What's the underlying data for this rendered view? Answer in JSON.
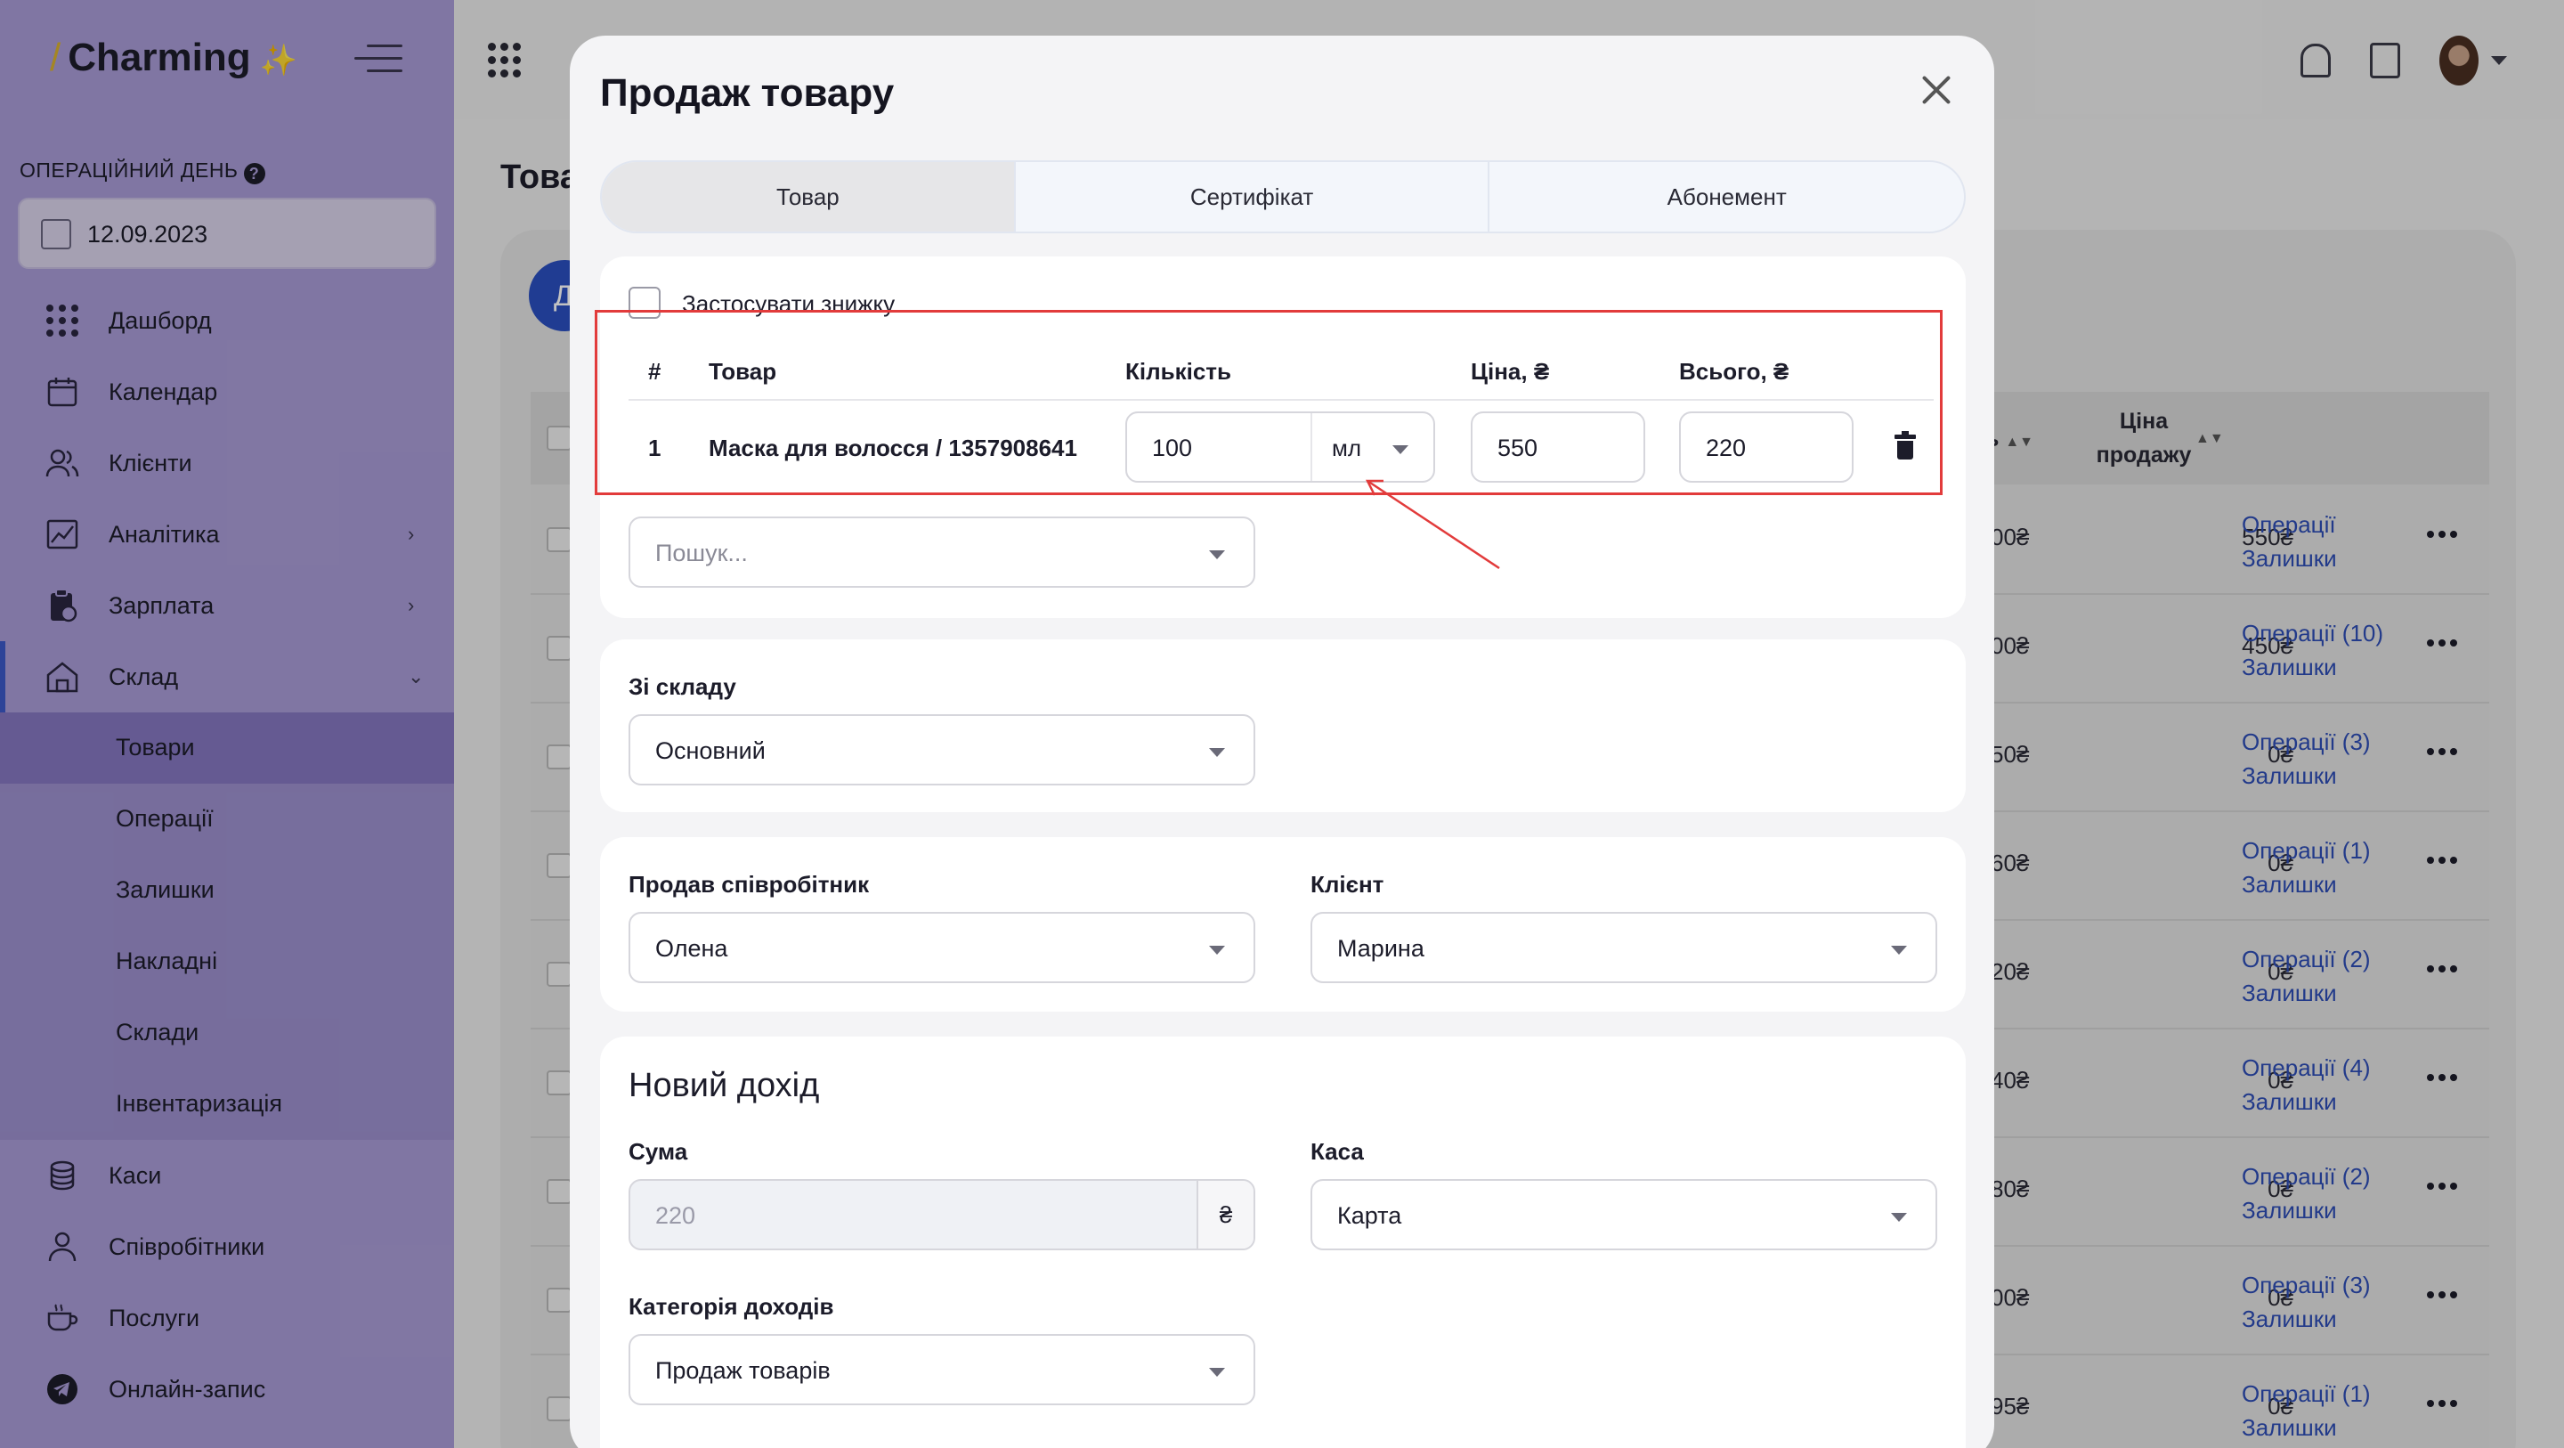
{
  "app": {
    "brand": "Charming",
    "brand_slash": "/",
    "brand_spark": "✨"
  },
  "sidebar": {
    "op_day_label": "ОПЕРАЦІЙНИЙ ДЕНЬ",
    "op_day_help": "?",
    "date_value": "12.09.2023",
    "items": [
      {
        "label": "Дашборд",
        "icon": "grid-icon"
      },
      {
        "label": "Календар",
        "icon": "calendar-icon"
      },
      {
        "label": "Клієнти",
        "icon": "users-icon"
      },
      {
        "label": "Аналітика",
        "icon": "chart-icon",
        "chevron": "›"
      },
      {
        "label": "Зарплата",
        "icon": "payroll-icon",
        "chevron": "›"
      },
      {
        "label": "Склад",
        "icon": "warehouse-icon",
        "chevron": "⌄"
      },
      {
        "label": "Каси",
        "icon": "coins-icon"
      },
      {
        "label": "Співробітники",
        "icon": "employee-icon"
      },
      {
        "label": "Послуги",
        "icon": "coffee-icon"
      },
      {
        "label": "Онлайн-запис",
        "icon": "telegram-icon"
      }
    ],
    "submenu": [
      {
        "label": "Товари",
        "selected": true
      },
      {
        "label": "Операції"
      },
      {
        "label": "Залишки"
      },
      {
        "label": "Накладні"
      },
      {
        "label": "Склади"
      },
      {
        "label": "Інвентаризація"
      }
    ]
  },
  "background_page": {
    "title_fragment": "Това",
    "add_button_fragment": "Д",
    "header_fragment_cost": "ь",
    "header_price_line1": "Ціна",
    "header_price_line2": "продажу",
    "rows": [
      {
        "cost": "00₴",
        "price": "550₴",
        "ops": "Операції",
        "stock": "Залишки"
      },
      {
        "cost": "00₴",
        "price": "450₴",
        "ops": "Операції (10)",
        "stock": "Залишки"
      },
      {
        "cost": "50₴",
        "price": "0₴",
        "ops": "Операції (3)",
        "stock": "Залишки"
      },
      {
        "cost": "60₴",
        "price": "0₴",
        "ops": "Операції (1)",
        "stock": "Залишки"
      },
      {
        "cost": "20₴",
        "price": "0₴",
        "ops": "Операції (2)",
        "stock": "Залишки"
      },
      {
        "cost": "40₴",
        "price": "0₴",
        "ops": "Операції (4)",
        "stock": "Залишки"
      },
      {
        "cost": "80₴",
        "price": "0₴",
        "ops": "Операції (2)",
        "stock": "Залишки"
      },
      {
        "cost": "00₴",
        "price": "0₴",
        "ops": "Операції (3)",
        "stock": "Залишки"
      },
      {
        "cost": "95₴",
        "price": "0₴",
        "ops": "Операції (1)",
        "stock": "Залишки"
      }
    ]
  },
  "modal": {
    "title": "Продаж товару",
    "tabs": [
      {
        "label": "Товар",
        "active": true
      },
      {
        "label": "Сертифікат"
      },
      {
        "label": "Абонемент"
      }
    ],
    "discount_label": "Застосувати знижку",
    "table": {
      "headers": [
        "#",
        "Товар",
        "Кількість",
        "Ціна, ₴",
        "Всього, ₴"
      ],
      "rows": [
        {
          "index": "1",
          "product": "Маска для волосся / 1357908641",
          "qty": "100",
          "unit": "мл",
          "price": "550",
          "total": "220"
        }
      ]
    },
    "search_placeholder": "Пошук...",
    "warehouse": {
      "label": "Зі складу",
      "value": "Основний"
    },
    "seller": {
      "label": "Продав співробітник",
      "value": "Олена"
    },
    "client": {
      "label": "Клієнт",
      "value": "Марина"
    },
    "income": {
      "title": "Новий дохід",
      "sum_label": "Сума",
      "sum_value": "220",
      "currency": "₴",
      "cash_label": "Каса",
      "cash_value": "Карта",
      "category_label": "Категорія доходів",
      "category_value": "Продаж товарів"
    }
  },
  "colors": {
    "sidebar_bg": "#a99cd6",
    "submenu_bg": "#9d90ce",
    "submenu_selected": "#8577c0",
    "accent_blue": "#2b4fc0",
    "link_blue": "#2d4db6",
    "annotation_red": "#e23b3b"
  }
}
